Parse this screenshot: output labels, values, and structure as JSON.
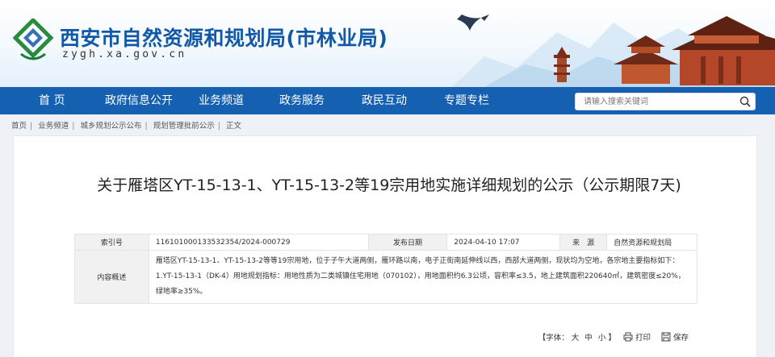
{
  "site": {
    "title": "西安市自然资源和规划局(市林业局)",
    "domain": "zygh.xa.gov.cn"
  },
  "nav": {
    "items": [
      "首 页",
      "政府信息公开",
      "业务频道",
      "政务服务",
      "政民互动",
      "专题专栏"
    ],
    "search_placeholder": "请输入搜索关键词"
  },
  "breadcrumb": [
    "首页",
    "业务频道",
    "城乡规划公示公布",
    "规划管理批前公示",
    "正文"
  ],
  "article": {
    "title": "关于雁塔区YT-15-13-1、YT-15-13-2等19宗用地实施详细规划的公示（公示期限7天)",
    "meta": {
      "index_label": "索引号",
      "index_value": "116101000133532354/2024-000729",
      "date_label": "发布日期",
      "date_value": "2024-04-10 17:07",
      "source_label": "来　源",
      "source_value": "自然资源和规划局",
      "summary_label": "内容概述",
      "summary_value": "雁塔区YT-15-13-1、YT-15-13-2等等19宗用地，位于子午大道两侧，雁环路以南，电子正街南延伸线以西，西部大道两侧，现状均为空地，各宗地主要指标如下：1.YT-15-13-1（DK-4）用地规划指标：用地性质为二类城镇住宅用地（070102），用地面积约6.3公顷，容积率≤3.5，地上建筑面积220640㎡，建筑密度≤20%，绿地率≥35%。"
    },
    "tools": {
      "font_label": "【字体：",
      "font_large": "大",
      "font_medium": "中",
      "font_small": "小",
      "font_close": "】",
      "print_label": "打印",
      "save_label": "保存"
    }
  },
  "colors": {
    "brand_blue": "#1159a8",
    "nav_blue": "#1560b1"
  }
}
